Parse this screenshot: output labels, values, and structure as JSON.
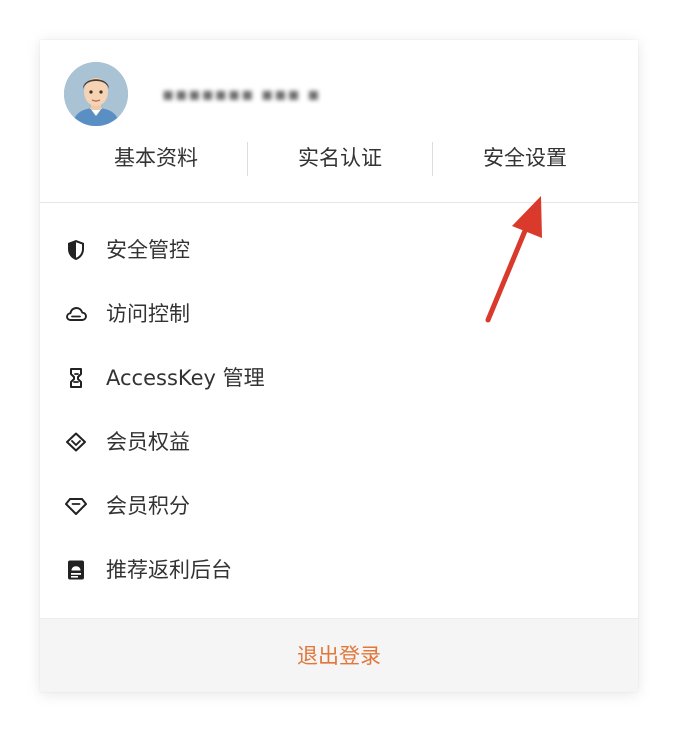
{
  "profile": {
    "username_masked": "▪▪▪▪▪▪▪ ▪▪▪ ▪"
  },
  "tabs": [
    {
      "label": "基本资料"
    },
    {
      "label": "实名认证"
    },
    {
      "label": "安全设置"
    }
  ],
  "menu": {
    "items": [
      {
        "label": "安全管控",
        "icon": "shield-icon"
      },
      {
        "label": "访问控制",
        "icon": "cloud-icon"
      },
      {
        "label": "AccessKey 管理",
        "icon": "key-bracket-icon"
      },
      {
        "label": "会员权益",
        "icon": "diamond-outline-icon"
      },
      {
        "label": "会员积分",
        "icon": "gem-icon"
      },
      {
        "label": "推荐返利后台",
        "icon": "rebate-panel-icon"
      }
    ]
  },
  "footer": {
    "logout_label": "退出登录"
  },
  "colors": {
    "accent": "#e2773a",
    "annotation_arrow": "#d93a2b",
    "text": "#333333",
    "footer_bg": "#f5f5f5"
  }
}
